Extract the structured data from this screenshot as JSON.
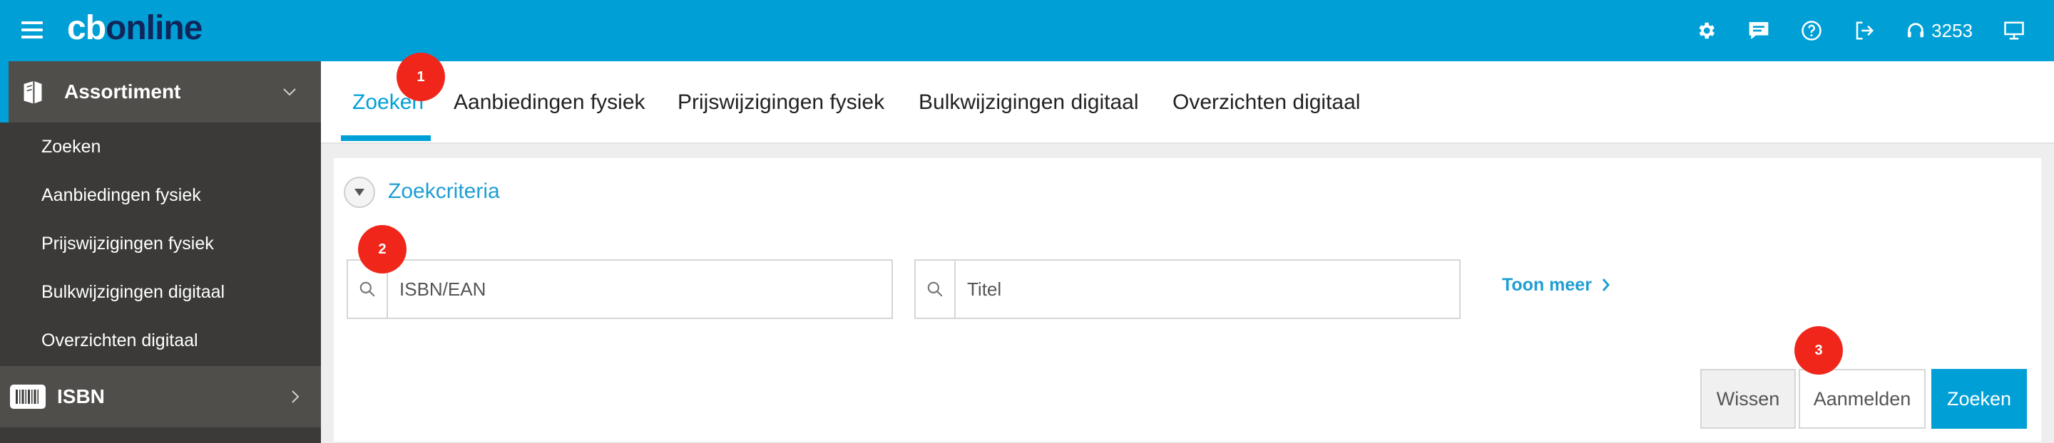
{
  "app": {
    "logo_part1": "cb",
    "logo_part2": "online",
    "support_number": "3253",
    "brand_color": "#00a0d6",
    "logo_dark_color": "#10265a"
  },
  "topbar_icons": [
    "gear-icon",
    "chat-icon",
    "help-icon",
    "logout-icon",
    "headset-icon",
    "monitor-icon"
  ],
  "sidebar": {
    "section_label": "Assortiment",
    "items": [
      {
        "label": "Zoeken"
      },
      {
        "label": "Aanbiedingen fysiek"
      },
      {
        "label": "Prijswijzigingen fysiek"
      },
      {
        "label": "Bulkwijzigingen digitaal"
      },
      {
        "label": "Overzichten digitaal"
      }
    ],
    "isbn_label": "ISBN"
  },
  "tabs": [
    {
      "label": "Zoeken",
      "active": true
    },
    {
      "label": "Aanbiedingen fysiek"
    },
    {
      "label": "Prijswijzigingen fysiek"
    },
    {
      "label": "Bulkwijzigingen digitaal"
    },
    {
      "label": "Overzichten digitaal"
    }
  ],
  "search": {
    "criteria_title": "Zoekcriteria",
    "isbn_placeholder": "ISBN/EAN",
    "isbn_value": "",
    "titel_placeholder": "Titel",
    "titel_value": "",
    "toon_meer": "Toon meer"
  },
  "buttons": {
    "wissen": "Wissen",
    "aanmelden": "Aanmelden",
    "zoeken": "Zoeken"
  },
  "markers": [
    "1",
    "2",
    "3"
  ]
}
